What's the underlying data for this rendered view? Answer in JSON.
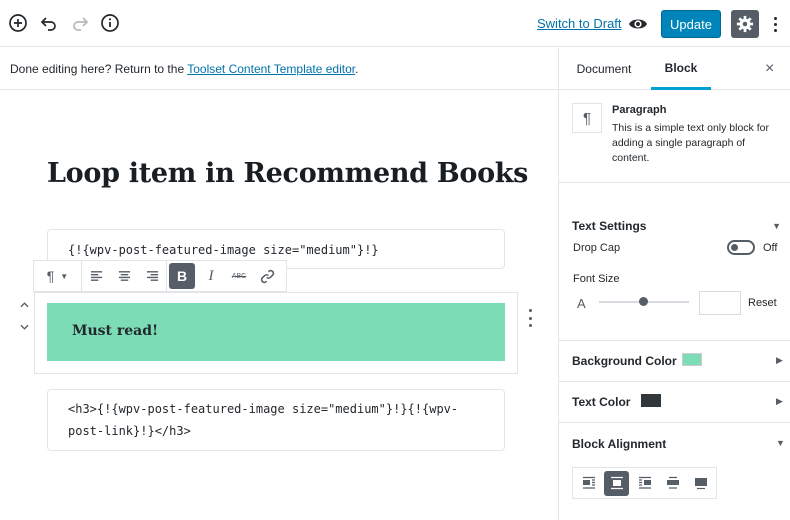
{
  "topbar": {
    "switch_to_draft": "Switch to Draft",
    "update": "Update",
    "icons": [
      "add-block-icon",
      "undo-icon",
      "redo-icon",
      "info-icon",
      "preview-eye-icon",
      "gear-icon",
      "more-vertical-icon"
    ]
  },
  "notice": {
    "prefix": "Done editing here? Return to the ",
    "link": "Toolset Content Template editor",
    "suffix": "."
  },
  "editor": {
    "post_title": "Loop item in Recommend Books",
    "code_block_1": "{!{wpv-post-featured-image size=\"medium\"}!}",
    "paragraph_text": "Must read!",
    "code_block_2_line1": "<h3>{!{wpv-post-featured-image size=\"medium\"}!}{!{wpv-",
    "code_block_2_line2": "post-link}!}</h3>",
    "paragraph_bg": "#7bdcb5"
  },
  "block_toolbar": {
    "paragraph_symbol": "¶",
    "bold_label": "B",
    "italic_label": "I",
    "strike_label": "ABC"
  },
  "sidebar": {
    "tab_document": "Document",
    "tab_block": "Block",
    "close": "×",
    "block_card": {
      "icon": "¶",
      "title": "Paragraph",
      "description": "This is a simple text only block for adding a single paragraph of content."
    },
    "text_settings": {
      "title": "Text Settings",
      "drop_cap_label": "Drop Cap",
      "drop_cap_state": "Off",
      "font_size_label": "Font Size",
      "font_size_icon": "A",
      "font_size_value": "",
      "reset": "Reset"
    },
    "background_color": {
      "label": "Background Color",
      "swatch": "#7bdcb5"
    },
    "text_color": {
      "label": "Text Color",
      "swatch": "#32373c"
    },
    "block_alignment": {
      "label": "Block Alignment",
      "active": "center"
    }
  }
}
